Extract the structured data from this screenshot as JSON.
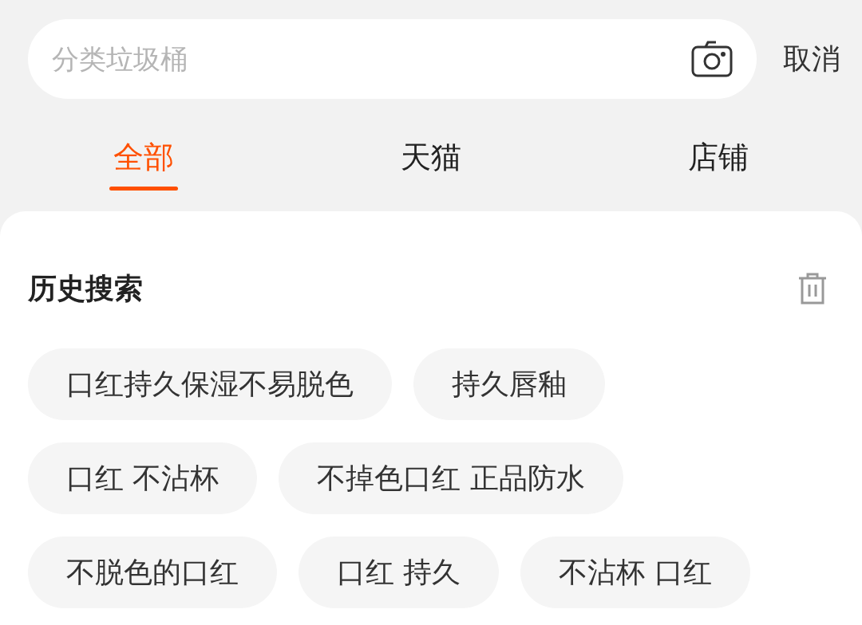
{
  "search": {
    "placeholder": "分类垃圾桶",
    "cancel": "取消"
  },
  "tabs": [
    {
      "label": "全部",
      "selected": true
    },
    {
      "label": "天猫",
      "selected": false
    },
    {
      "label": "店铺",
      "selected": false
    }
  ],
  "history": {
    "title": "历史搜索",
    "items": [
      "口红持久保湿不易脱色",
      "持久唇釉",
      "口红 不沾杯",
      "不掉色口红 正品防水",
      "不脱色的口红",
      "口红 持久",
      "不沾杯 口红"
    ]
  }
}
